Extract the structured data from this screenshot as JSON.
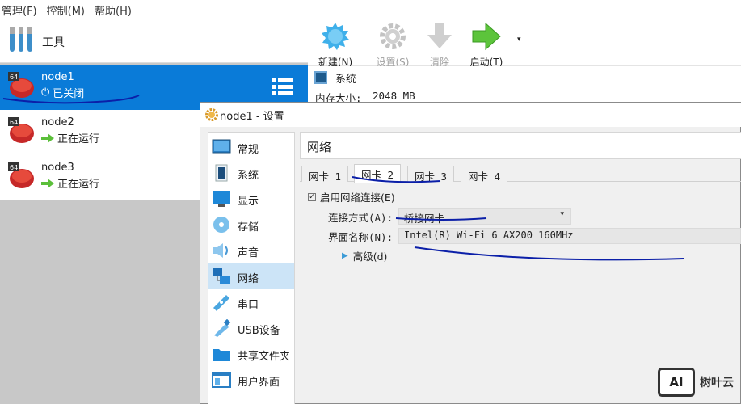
{
  "menubar": {
    "items": [
      "管理(F)",
      "控制(M)",
      "帮助(H)"
    ]
  },
  "sidebar": {
    "tools_label": "工具",
    "vms": [
      {
        "name": "node1",
        "status": "已关闭",
        "selected": true,
        "badge": "64"
      },
      {
        "name": "node2",
        "status": "正在运行",
        "selected": false,
        "badge": "64"
      },
      {
        "name": "node3",
        "status": "正在运行",
        "selected": false,
        "badge": "64"
      }
    ]
  },
  "toolbar": {
    "new_label": "新建(N)",
    "settings_label": "设置(S)",
    "discard_label": "清除",
    "start_label": "启动(T)"
  },
  "details": {
    "system_label": "系统",
    "memory_label": "内存大小:",
    "memory_value": "2048 MB"
  },
  "dialog": {
    "title": "node1 - 设置",
    "categories": [
      {
        "label": "常规",
        "icon": "general-icon"
      },
      {
        "label": "系统",
        "icon": "system-icon"
      },
      {
        "label": "显示",
        "icon": "display-icon"
      },
      {
        "label": "存储",
        "icon": "storage-icon"
      },
      {
        "label": "声音",
        "icon": "audio-icon"
      },
      {
        "label": "网络",
        "icon": "network-icon",
        "active": true
      },
      {
        "label": "串口",
        "icon": "serial-port-icon"
      },
      {
        "label": "USB设备",
        "icon": "usb-icon"
      },
      {
        "label": "共享文件夹",
        "icon": "shared-folder-icon"
      },
      {
        "label": "用户界面",
        "icon": "user-interface-icon"
      }
    ],
    "section_title": "网络",
    "tabs": [
      {
        "label": "网卡 1"
      },
      {
        "label": "网卡 2",
        "active": true
      },
      {
        "label": "网卡 3"
      },
      {
        "label": "网卡 4"
      }
    ],
    "enable_label": "启用网络连接(E)",
    "attached_label": "连接方式(A):",
    "attached_value": "桥接网卡",
    "name_label": "界面名称(N):",
    "name_value": "Intel(R) Wi-Fi 6 AX200 160MHz",
    "advanced_label": "高级(d)"
  },
  "watermark": {
    "box": "AI",
    "text": "树叶云"
  },
  "colors": {
    "selection": "#0a7bd8",
    "accent": "#3c9bd6",
    "annotation": "#0b1fa8"
  }
}
